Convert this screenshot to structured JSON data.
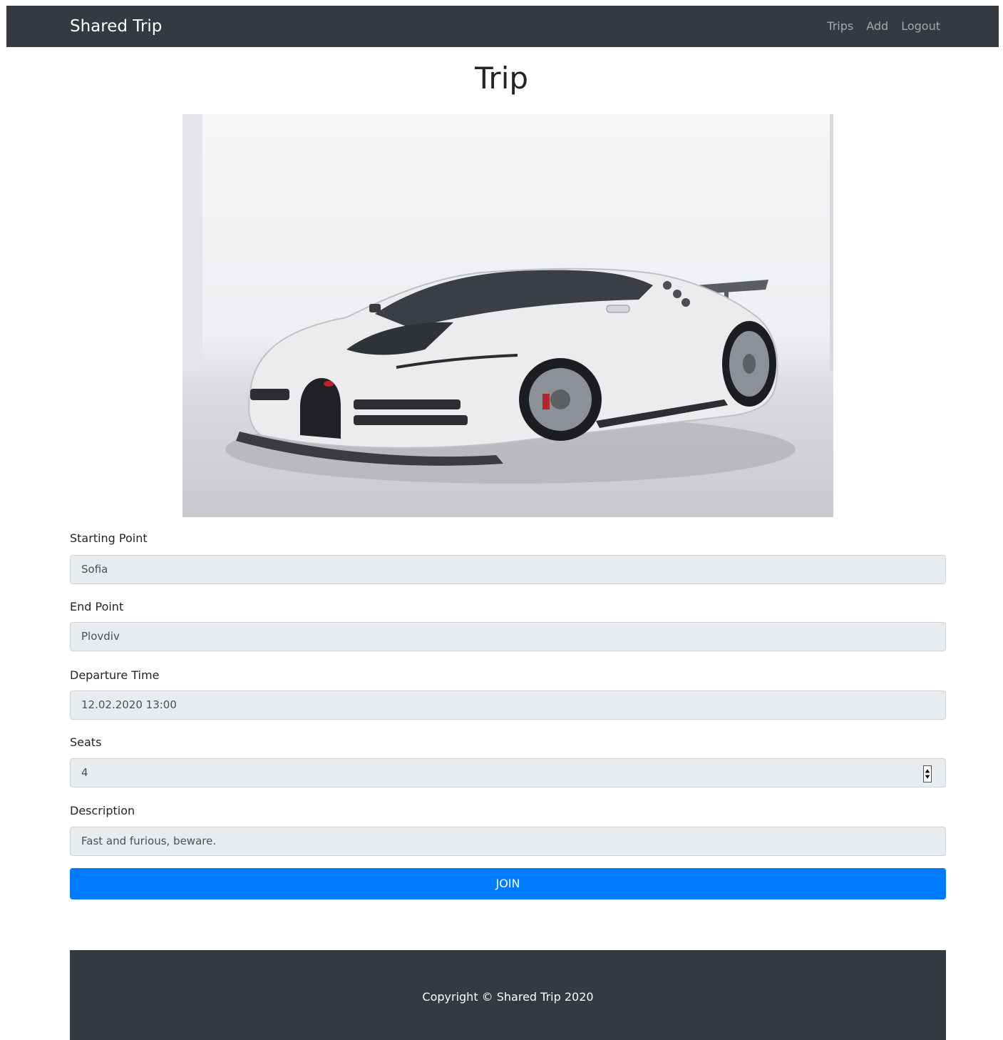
{
  "navbar": {
    "brand": "Shared Trip",
    "links": [
      "Trips",
      "Add",
      "Logout"
    ]
  },
  "page": {
    "title": "Trip"
  },
  "image": {
    "subject": "white sports car"
  },
  "form": {
    "starting_point": {
      "label": "Starting Point",
      "value": "Sofia"
    },
    "end_point": {
      "label": "End Point",
      "value": "Plovdiv"
    },
    "departure_time": {
      "label": "Departure Time",
      "value": "12.02.2020 13:00"
    },
    "seats": {
      "label": "Seats",
      "value": "4"
    },
    "description": {
      "label": "Description",
      "value": "Fast and furious, beware."
    }
  },
  "join_button": {
    "label": "JOIN"
  },
  "footer": {
    "text": "Copyright © Shared Trip 2020"
  },
  "colors": {
    "navbar_bg": "#343a40",
    "primary": "#007bff",
    "input_bg": "#e9ecef"
  }
}
